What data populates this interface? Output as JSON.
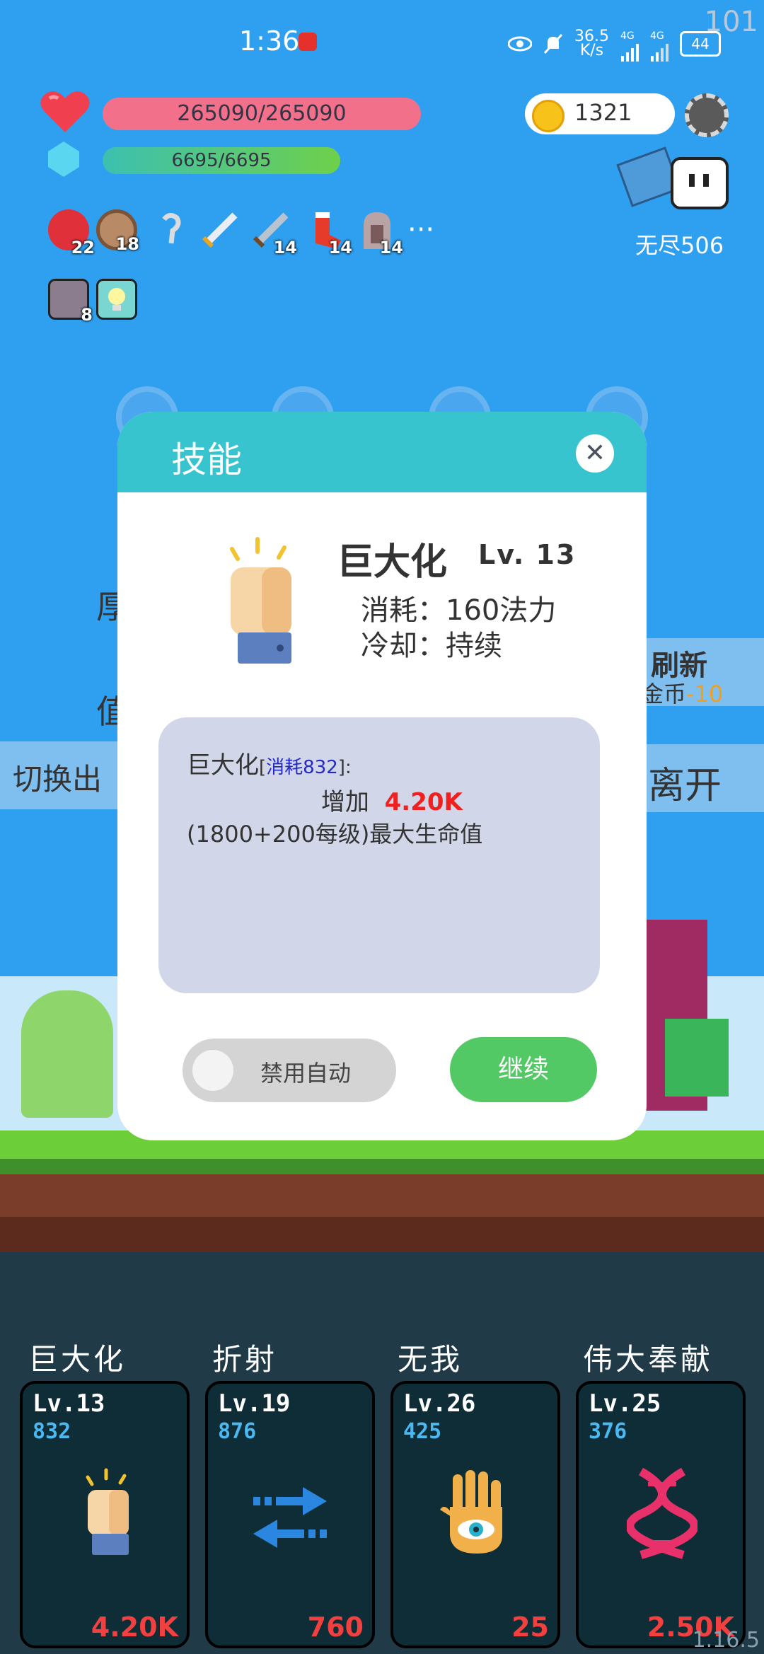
{
  "status_bar": {
    "time": "1:36",
    "speed": "36.5",
    "speed_unit": "K/s",
    "battery": "44",
    "signal_1": "4G",
    "signal_2": "4G"
  },
  "fps": "101",
  "hud": {
    "hp": "265090/265090",
    "mp": "6695/6695",
    "coins": "1321",
    "mode": "无尽506",
    "items": [
      {
        "icon": "apple-icon",
        "count": "22"
      },
      {
        "icon": "shield-icon",
        "count": "18"
      },
      {
        "icon": "hook-icon",
        "count": ""
      },
      {
        "icon": "sword-icon",
        "count": ""
      },
      {
        "icon": "sword-icon",
        "count": "14"
      },
      {
        "icon": "sock-icon",
        "count": "14"
      },
      {
        "icon": "tombstone-icon",
        "count": "14"
      }
    ],
    "more": "···",
    "items_row2": [
      {
        "icon": "blade-box-icon",
        "count": "8"
      },
      {
        "icon": "lightbulb-icon",
        "count": ""
      }
    ]
  },
  "background": {
    "refresh_title": "刷新",
    "refresh_sub": "金币",
    "refresh_cost": "-10",
    "leave": "离开",
    "switch": "切换出",
    "left_char_1": "厚",
    "left_char_2": "值"
  },
  "modal": {
    "title": "技能",
    "skill_name": "巨大化",
    "skill_level": "Lv. 13",
    "cost_line": "消耗：160法力",
    "cooldown_line": "冷却：持续",
    "desc_name": "巨大化",
    "desc_tag_open": "[",
    "desc_tag": "消耗832",
    "desc_tag_close": "]:",
    "desc_prefix": "增加",
    "desc_value": "4.20K",
    "desc_formula": "(1800+200每级)最大生命值",
    "toggle_label": "禁用自动",
    "continue": "继续"
  },
  "skills": [
    {
      "name": "巨大化",
      "level": "Lv.13",
      "cost": "832",
      "value": "4.20K",
      "icon": "fist-icon"
    },
    {
      "name": "折射",
      "level": "Lv.19",
      "cost": "876",
      "value": "760",
      "icon": "swap-arrows-icon"
    },
    {
      "name": "无我",
      "level": "Lv.26",
      "cost": "425",
      "value": "25",
      "icon": "eye-hand-icon"
    },
    {
      "name": "伟大奉献",
      "level": "Lv.25",
      "cost": "376",
      "value": "2.50K",
      "icon": "dna-icon"
    }
  ],
  "version": "1.16.5",
  "colors": {
    "sky": "#2f9ff0",
    "modal_header": "#38c4cf",
    "continue": "#52c964",
    "value_red": "#f04040",
    "cost_blue": "#4bb8f2"
  }
}
